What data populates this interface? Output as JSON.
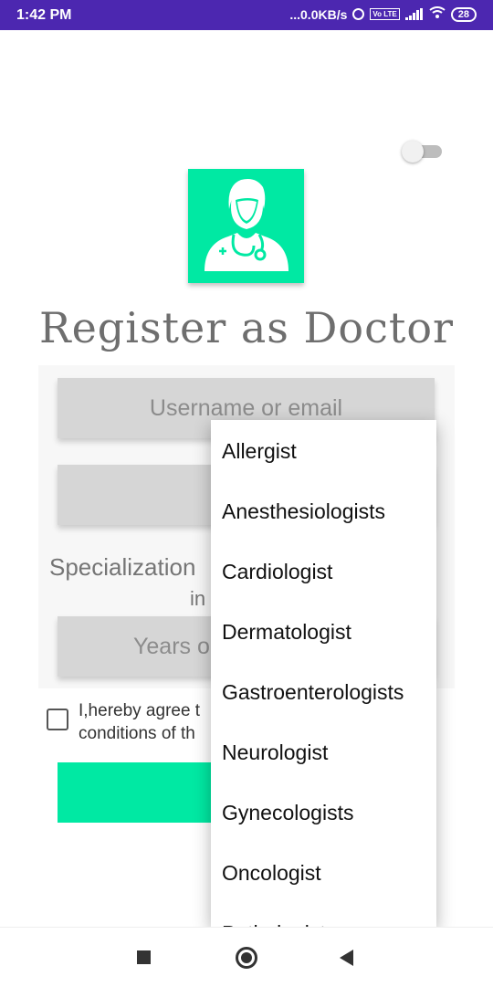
{
  "status_bar": {
    "time": "1:42 PM",
    "network_speed": "...0.0KB/s",
    "volte": "Vo LTE",
    "battery": "28"
  },
  "header": {
    "title": "Register as Doctor"
  },
  "form": {
    "username_placeholder": "Username or email",
    "password_placeholder": "",
    "specialization_label": "Specialization",
    "specialization_sub": "in",
    "years_placeholder": "Years o",
    "agree_line1": "I,hereby agree t",
    "agree_line2": "conditions of th"
  },
  "dropdown": {
    "items": [
      "Allergist",
      "Anesthesiologists",
      "Cardiologist",
      "Dermatologist",
      "Gastroenterologists",
      "Neurologist",
      "Gynecologists",
      "Oncologist",
      "Pathologist"
    ]
  },
  "colors": {
    "status_bar": "#4c27b0",
    "accent": "#00e9a3",
    "title": "#6e6e6e"
  }
}
